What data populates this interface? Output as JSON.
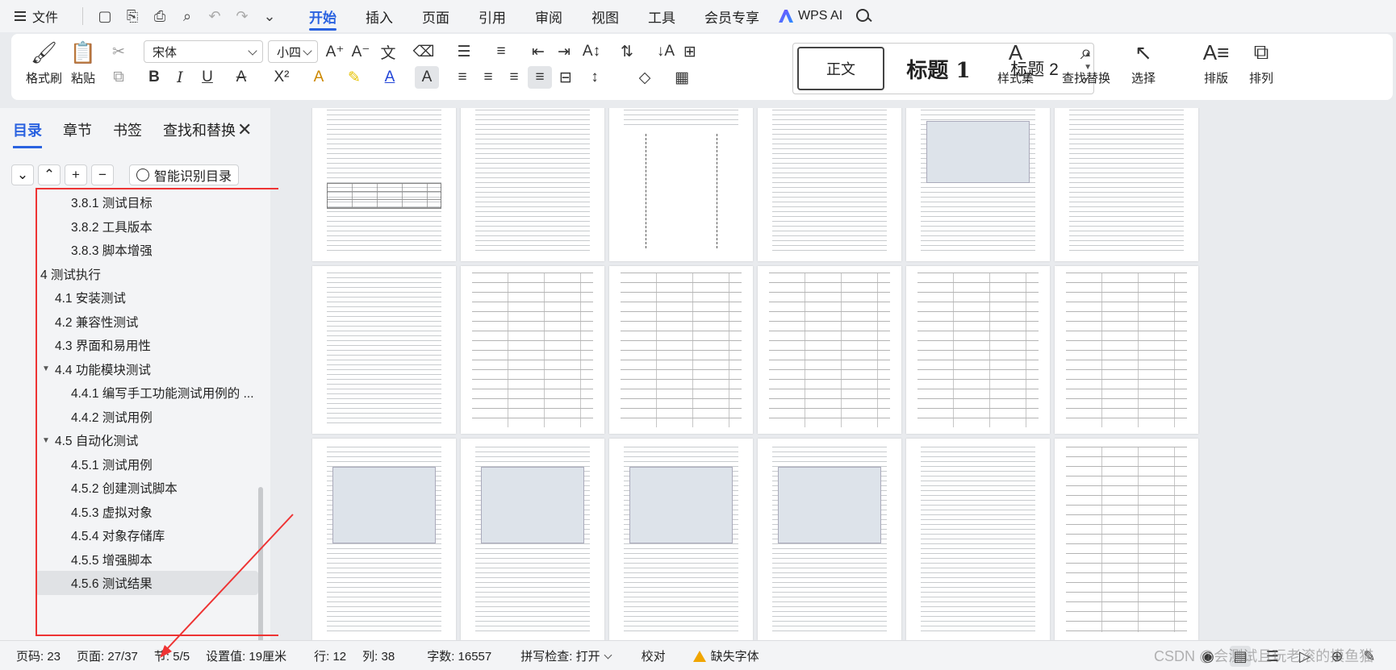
{
  "menubar": {
    "file_label": "文件",
    "tabs": [
      "开始",
      "插入",
      "页面",
      "引用",
      "审阅",
      "视图",
      "工具",
      "会员专享"
    ],
    "active_tab": "开始",
    "ai_label": "WPS AI"
  },
  "ribbon": {
    "format_painter": "格式刷",
    "paste": "粘贴",
    "font_name": "宋体",
    "font_size": "小四",
    "styles": {
      "normal": "正文",
      "heading1": "标题 1",
      "heading2": "标题 2"
    },
    "styles_set": "样式集",
    "find_replace": "查找替换",
    "select": "选择",
    "layout": "排版",
    "arrange": "排列"
  },
  "nav": {
    "tabs": [
      "目录",
      "章节",
      "书签",
      "查找和替换"
    ],
    "active_tab": "目录",
    "smart_toc": "智能识别目录",
    "toc": [
      {
        "label": "3.8.1 测试目标",
        "level": 3
      },
      {
        "label": "3.8.2 工具版本",
        "level": 3
      },
      {
        "label": "3.8.3 脚本增强",
        "level": 3
      },
      {
        "label": "4 测试执行",
        "level": 1,
        "expanded": true
      },
      {
        "label": "4.1 安装测试",
        "level": 2
      },
      {
        "label": "4.2 兼容性测试",
        "level": 2
      },
      {
        "label": "4.3 界面和易用性",
        "level": 2
      },
      {
        "label": "4.4 功能模块测试",
        "level": 2,
        "expanded": true
      },
      {
        "label": "4.4.1 编写手工功能测试用例的 ...",
        "level": 3
      },
      {
        "label": "4.4.2 测试用例",
        "level": 3
      },
      {
        "label": "4.5 自动化测试",
        "level": 2,
        "expanded": true
      },
      {
        "label": "4.5.1 测试用例",
        "level": 3
      },
      {
        "label": "4.5.2 创建测试脚本",
        "level": 3
      },
      {
        "label": "4.5.3 虚拟对象",
        "level": 3
      },
      {
        "label": "4.5.4 对象存储库",
        "level": 3
      },
      {
        "label": "4.5.5 增强脚本",
        "level": 3
      },
      {
        "label": "4.5.6 测试结果",
        "level": 3,
        "current": true
      }
    ]
  },
  "status": {
    "page_code": "页码: 23",
    "page": "页面: 27/37",
    "section": "节: 5/5",
    "setting": "设置值: 19厘米",
    "row": "行: 12",
    "col": "列: 38",
    "word_count": "字数: 16557",
    "spell_check": "拼写检查: 打开",
    "proofread": "校对",
    "missing_font": "缺失字体"
  },
  "watermark": "CSDN @会测试且玩老滚的摸鱼猫",
  "colors": {
    "accent": "#2a62e0",
    "annotation": "#e33333"
  }
}
